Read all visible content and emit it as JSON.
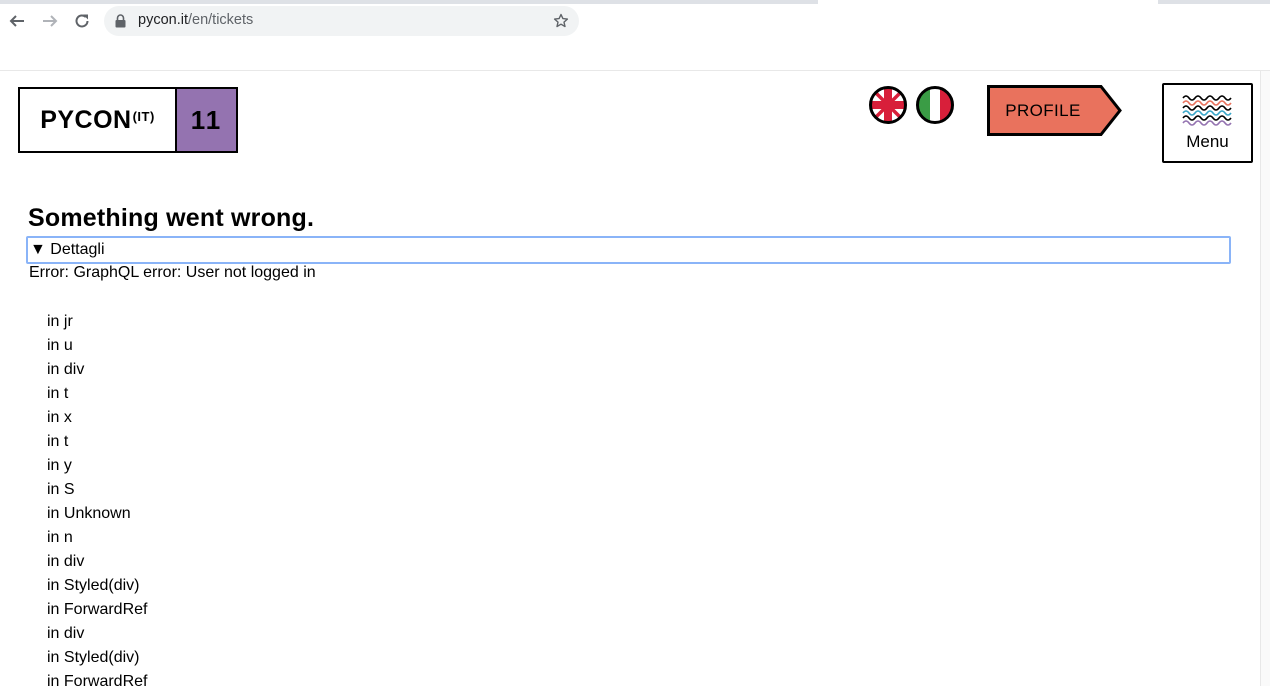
{
  "browser": {
    "url_host": "pycon.it",
    "url_path": "/en/tickets"
  },
  "header": {
    "logo_name": "PYCON",
    "logo_suffix": "(IT)",
    "logo_edition": "11",
    "profile_label": "PROFILE",
    "menu_label": "Menu",
    "colors": {
      "edition_bg": "#9473b0",
      "profile_bg": "#e9725d"
    }
  },
  "error": {
    "title": "Something went wrong.",
    "summary": "▼ Dettagli",
    "message": "Error: GraphQL error: User not logged in",
    "stack": [
      "in jr",
      "in u",
      "in div",
      "in t",
      "in x",
      "in t",
      "in y",
      "in S",
      "in Unknown",
      "in n",
      "in div",
      "in Styled(div)",
      "in ForwardRef",
      "in div",
      "in Styled(div)",
      "in ForwardRef"
    ]
  }
}
